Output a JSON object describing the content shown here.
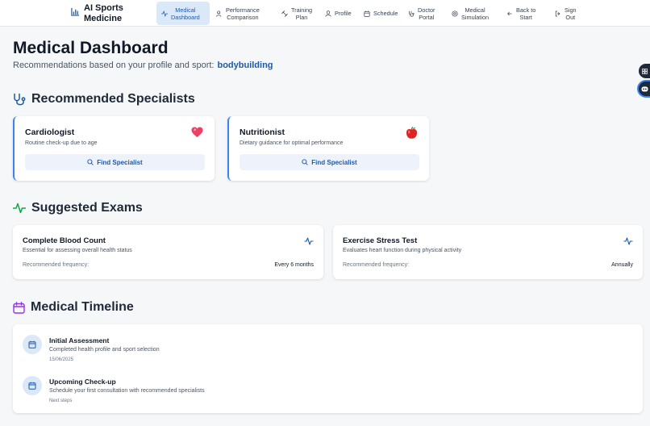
{
  "brand": {
    "line1": "AI Sports",
    "line2": "Medicine"
  },
  "nav": [
    {
      "line1": "Medical",
      "line2": "Dashboard",
      "icon": "activity-icon",
      "active": true
    },
    {
      "line1": "Performance",
      "line2": "Comparison",
      "icon": "users-icon",
      "active": false
    },
    {
      "line1": "Training",
      "line2": "Plan",
      "icon": "dumbbell-icon",
      "active": false
    },
    {
      "line1": "Profile",
      "line2": "",
      "icon": "user-icon",
      "active": false
    },
    {
      "line1": "Schedule",
      "line2": "",
      "icon": "calendar-icon",
      "active": false
    },
    {
      "line1": "Doctor",
      "line2": "Portal",
      "icon": "stethoscope-icon",
      "active": false
    },
    {
      "line1": "Medical",
      "line2": "Simulation",
      "icon": "target-icon",
      "active": false
    },
    {
      "line1": "Back to",
      "line2": "Start",
      "icon": "arrow-left-icon",
      "active": false
    },
    {
      "line1": "Sign",
      "line2": "Out",
      "icon": "logout-icon",
      "active": false
    }
  ],
  "page": {
    "title": "Medical Dashboard",
    "subtitle": "Recommendations based on your profile and sport:",
    "sport": "bodybuilding"
  },
  "specialists": {
    "heading": "Recommended Specialists",
    "button_label": "Find Specialist",
    "items": [
      {
        "name": "Cardiologist",
        "description": "Routine check-up due to age",
        "icon": "heart-emoji-icon"
      },
      {
        "name": "Nutritionist",
        "description": "Dietary guidance for optimal performance",
        "icon": "apple-emoji-icon"
      }
    ]
  },
  "exams": {
    "heading": "Suggested Exams",
    "frequency_label": "Recommended frequency:",
    "items": [
      {
        "name": "Complete Blood Count",
        "description": "Essential for assessing overall health status",
        "frequency": "Every 6 months"
      },
      {
        "name": "Exercise Stress Test",
        "description": "Evaluates heart function during physical activity",
        "frequency": "Annually"
      }
    ]
  },
  "timeline": {
    "heading": "Medical Timeline",
    "items": [
      {
        "title": "Initial Assessment",
        "description": "Completed health profile and sport selection",
        "meta": "15/06/2025"
      },
      {
        "title": "Upcoming Check-up",
        "description": "Schedule your first consultation with recommended specialists",
        "meta": "Next steps"
      }
    ]
  },
  "colors": {
    "accent": "#1e5aa8",
    "accent_soft": "#dbe8f8",
    "exam_green": "#16a34a",
    "timeline_purple": "#9333ea"
  }
}
